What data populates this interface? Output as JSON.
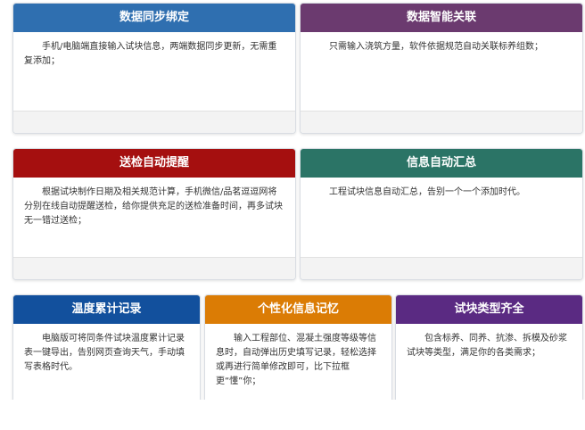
{
  "colors": {
    "blue": "#2f6fb0",
    "purple": "#6b3a6f",
    "red": "#a50f0f",
    "teal": "#2b7466",
    "navy": "#12509d",
    "orange": "#db7c05",
    "violet": "#5a2a82"
  },
  "cards": [
    {
      "title": "数据同步绑定",
      "text": "手机/电脑端直接输入试块信息，两端数据同步更新，无需重复添加；"
    },
    {
      "title": "数据智能关联",
      "text": "只需输入浇筑方量，软件依据规范自动关联标养组数；"
    },
    {
      "title": "送检自动提醒",
      "text": "根据试块制作日期及相关规范计算，手机微信/品茗逗逗网将分别在线自动提醒送检，给你提供充足的送检准备时间，再多试块无一错过送检；"
    },
    {
      "title": "信息自动汇总",
      "text": "工程试块信息自动汇总，告别一个一个添加时代。"
    },
    {
      "title": "温度累计记录",
      "text": "电脑版可将同条件试块温度累计记录表一键导出，告别网页查询天气，手动填写表格时代。"
    },
    {
      "title": "个性化信息记忆",
      "text": "输入工程部位、混凝土强度等级等信息时，自动弹出历史填写记录，轻松选择或再进行简单修改即可，比下拉框更“懂”你；"
    },
    {
      "title": "试块类型齐全",
      "text": "包含标养、同养、抗渗、拆模及砂浆试块等类型，满足你的各类需求；"
    }
  ]
}
